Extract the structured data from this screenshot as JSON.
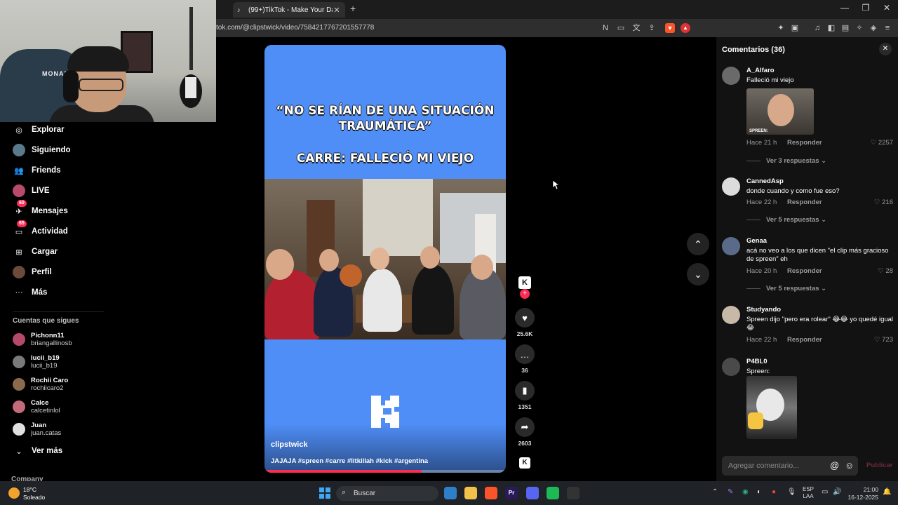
{
  "browser": {
    "tab_title": "(99+)TikTok - Make Your Day",
    "tab_close": "✕",
    "new_tab": "+",
    "url": "tok.com/@clipstwick/video/7584217767201557778",
    "minimize": "—",
    "maximize": "❐",
    "close": "✕",
    "toolbar_icons": [
      "reader-icon",
      "cast-icon",
      "translate-icon",
      "share-icon",
      "brave-shields-icon",
      "brave-rewards-icon",
      "extensions-icon",
      "wallet-icon",
      "media-icon",
      "sidebar-icon",
      "wallet2-icon",
      "leo-icon",
      "vpn-icon",
      "menu-icon"
    ]
  },
  "webcam": {
    "chair_brand": "MONARCH"
  },
  "sidebar": {
    "nav": [
      {
        "label": "Explorar",
        "icon": "compass-icon",
        "glyph": "◎"
      },
      {
        "label": "Siguiendo",
        "icon": "following-avatar-icon",
        "glyph": ""
      },
      {
        "label": "Friends",
        "icon": "friends-icon",
        "glyph": "👥"
      },
      {
        "label": "LIVE",
        "icon": "live-avatar-icon",
        "glyph": ""
      },
      {
        "label": "Mensajes",
        "icon": "messages-icon",
        "glyph": "✈",
        "badge": "60"
      },
      {
        "label": "Actividad",
        "icon": "activity-icon",
        "glyph": "▭",
        "badge": "65"
      },
      {
        "label": "Cargar",
        "icon": "upload-icon",
        "glyph": "⊞"
      },
      {
        "label": "Perfil",
        "icon": "profile-avatar-icon",
        "glyph": ""
      },
      {
        "label": "Más",
        "icon": "more-icon",
        "glyph": "···"
      }
    ],
    "following_label": "Cuentas que sigues",
    "following": [
      {
        "name": "Pichonn11",
        "user": "briangallinosb",
        "color": "#b44a6a"
      },
      {
        "name": "lucii_b19",
        "user": "lucii_b19",
        "color": "#7a7a7a"
      },
      {
        "name": "Rochii Caro",
        "user": "rochiicaro2",
        "color": "#8a6a4a"
      },
      {
        "name": "Calce",
        "user": "calcetinlol",
        "color": "#c46a7a"
      },
      {
        "name": "Juan",
        "user": "juan.catas",
        "color": "#e0e0e0"
      }
    ],
    "see_more": "Ver más",
    "company": "Company"
  },
  "video": {
    "title_line1": "“NO SE RÍAN DE UNA SITUACIÓN",
    "title_line2": "TRAUMÁTICA”",
    "title_line3": "CARRE: FALLECIÓ MI VIEJO",
    "author": "clipstwick",
    "caption": "JAJAJA #spreen #carre #litkillah #kick #argentina",
    "progress": 0.65
  },
  "actions": {
    "likes": "25.6K",
    "comments": "36",
    "saves": "1351",
    "shares": "2603",
    "avatar_letter": "K"
  },
  "comments": {
    "header": "Comentarios (36)",
    "items": [
      {
        "user": "A_Alfaro",
        "text": "Falleció mi viejo",
        "time": "Hace 21 h",
        "reply": "Responder",
        "likes": "2257",
        "more": "Ver 3 respuestas ⌄",
        "img_label": "SPREEN:",
        "avatar": "#6a6a6a"
      },
      {
        "user": "CannedAsp",
        "text": "donde cuando y como fue eso?",
        "time": "Hace 22 h",
        "reply": "Responder",
        "likes": "216",
        "more": "Ver 5 respuestas ⌄",
        "avatar": "#dcdcdc"
      },
      {
        "user": "Genaa",
        "text": "acá no veo a los que dicen \"el clip más gracioso de spreen\" eh",
        "time": "Hace 20 h",
        "reply": "Responder",
        "likes": "28",
        "more": "Ver 5 respuestas ⌄",
        "avatar": "#5a6b8a"
      },
      {
        "user": "Studyando",
        "text": "Spreen dijo \"pero era rolear\" 😂😂 yo quedé igual😂",
        "time": "Hace 22 h",
        "reply": "Responder",
        "likes": "723",
        "avatar": "#c8b8a8"
      },
      {
        "user": "P4BL0",
        "text": "Spreen:",
        "avatar": "#4a4a4a"
      }
    ],
    "placeholder": "Agregar comentario...",
    "mention": "@",
    "emoji": "☺",
    "post": "Publicar"
  },
  "taskbar": {
    "temp": "18°C",
    "condition": "Soleado",
    "search": "Buscar",
    "lang1": "ESP",
    "lang2": "LAA",
    "time": "21:00",
    "date": "16-12-2025",
    "apps": [
      {
        "name": "widgets-app",
        "label": "",
        "color": "#2f7fc8"
      },
      {
        "name": "file-explorer-app",
        "label": "",
        "color": "#f2c14a"
      },
      {
        "name": "brave-app",
        "label": "",
        "color": "#fb542b"
      },
      {
        "name": "premiere-app",
        "label": "Pr",
        "color": "#2a1a5a"
      },
      {
        "name": "discord-app",
        "label": "",
        "color": "#5865f2"
      },
      {
        "name": "spotify-app",
        "label": "",
        "color": "#1db954"
      },
      {
        "name": "obs-app",
        "label": "",
        "color": "#333"
      }
    ]
  }
}
